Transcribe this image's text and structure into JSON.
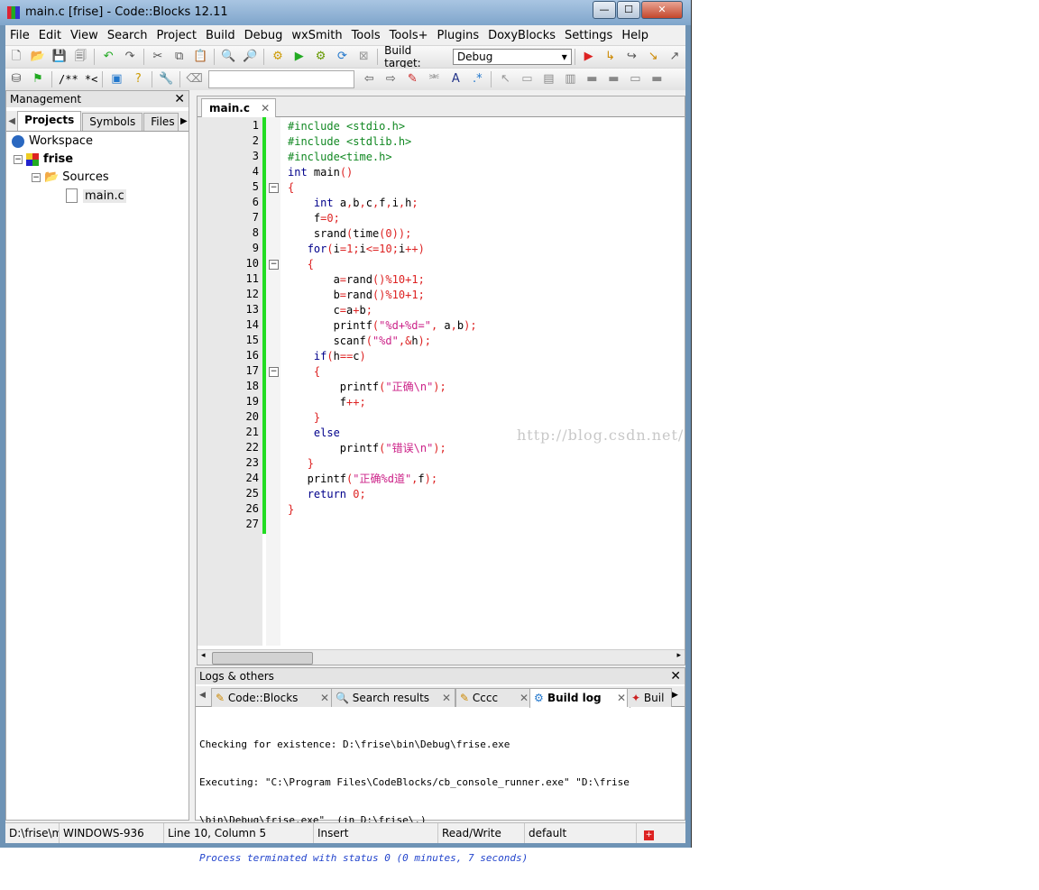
{
  "window": {
    "title": "main.c [frise] - Code::Blocks 12.11",
    "min_glyph": "—",
    "max_glyph": "☐",
    "close_glyph": "✕"
  },
  "menu": [
    "File",
    "Edit",
    "View",
    "Search",
    "Project",
    "Build",
    "Debug",
    "wxSmith",
    "Tools",
    "Tools+",
    "Plugins",
    "DoxyBlocks",
    "Settings",
    "Help"
  ],
  "toolbar": {
    "build_target_label": "Build target:",
    "build_target_value": "Debug",
    "doc_comment": "/** *<"
  },
  "management": {
    "title": "Management",
    "close_glyph": "✕",
    "tabs": [
      "Projects",
      "Symbols",
      "Files"
    ],
    "active_tab": "Projects",
    "tree": {
      "workspace": "Workspace",
      "project": "frise",
      "folder": "Sources",
      "file": "main.c"
    }
  },
  "editor": {
    "tab_label": "main.c",
    "tab_close": "✕",
    "watermark": "http://blog.csdn.net/",
    "line_numbers": [
      "1",
      "2",
      "3",
      "4",
      "5",
      "6",
      "7",
      "8",
      "9",
      "10",
      "11",
      "12",
      "13",
      "14",
      "15",
      "16",
      "17",
      "18",
      "19",
      "20",
      "21",
      "22",
      "23",
      "24",
      "25",
      "26",
      "27"
    ],
    "lines": [
      "#include <stdio.h>",
      "#include <stdlib.h>",
      "#include<time.h>",
      "int main()",
      "{",
      "    int a,b,c,f,i,h;",
      "    f=0;",
      "    srand(time(0));",
      "   for(i=1;i<=10;i++)",
      "   {",
      "       a=rand()%10+1;",
      "       b=rand()%10+1;",
      "       c=a+b;",
      "       printf(\"%d+%d=\", a,b);",
      "       scanf(\"%d\",&h);",
      "    if(h==c)",
      "    {",
      "        printf(\"正确\\n\");",
      "        f++;",
      "    }",
      "    else",
      "        printf(\"错误\\n\");",
      "   }",
      "   printf(\"正确%d道\",f);",
      "   return 0;",
      "}",
      ""
    ]
  },
  "logs": {
    "title": "Logs & others",
    "close_glyph": "✕",
    "tabs": [
      "Code::Blocks",
      "Search results",
      "Cccc",
      "Build log",
      "Buil"
    ],
    "active_tab": "Build log",
    "lines": [
      "Checking for existence: D:\\frise\\bin\\Debug\\frise.exe",
      "Executing: \"C:\\Program Files\\CodeBlocks/cb_console_runner.exe\" \"D:\\frise",
      "\\bin\\Debug\\frise.exe\"  (in D:\\frise\\.)",
      "Process terminated with status 0 (0 minutes, 7 seconds)"
    ]
  },
  "statusbar": {
    "path": "D:\\frise\\m",
    "encoding": "WINDOWS-936",
    "position": "Line 10, Column 5",
    "mode": "Insert",
    "access": "Read/Write",
    "profile": "default"
  },
  "colors": {
    "preprocessor": "#118822",
    "keyword": "#00008b",
    "number": "#dd2222",
    "string": "#cc2288",
    "changebar": "#22dd22"
  }
}
